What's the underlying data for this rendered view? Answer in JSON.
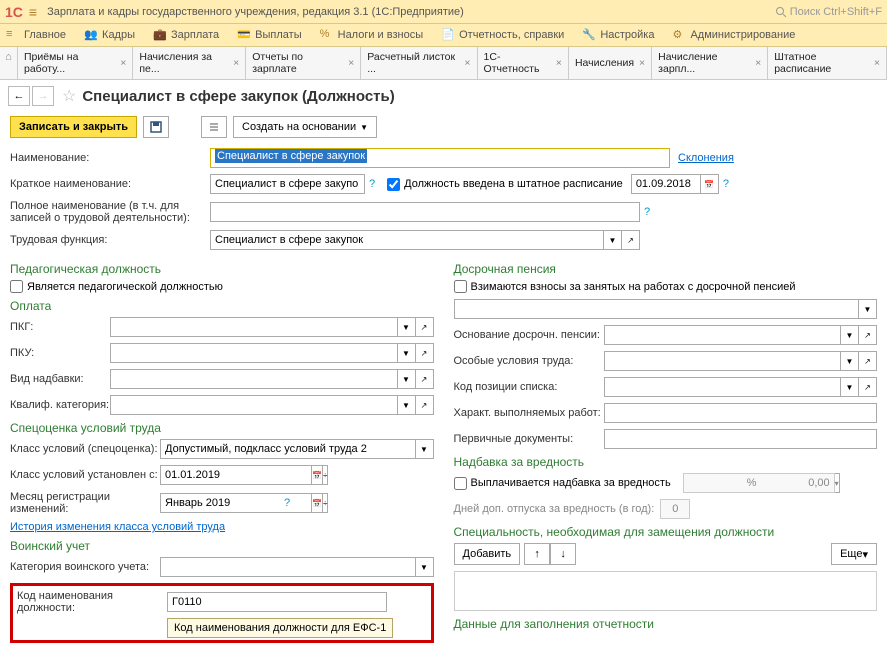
{
  "title": "Зарплата и кадры государственного учреждения, редакция 3.1 (1С:Предприятие)",
  "searchPlaceholder": "Поиск Ctrl+Shift+F",
  "menu": [
    "Главное",
    "Кадры",
    "Зарплата",
    "Выплаты",
    "Налоги и взносы",
    "Отчетность, справки",
    "Настройка",
    "Администрирование"
  ],
  "tabs": [
    "Приёмы на работу...",
    "Начисления за пе...",
    "Отчеты по зарплате",
    "Расчетный листок ...",
    "1С-Отчетность",
    "Начисления",
    "Начисление зарпл...",
    "Штатное расписание"
  ],
  "pageTitle": "Специалист в сфере закупок (Должность)",
  "toolbar": {
    "save": "Записать и закрыть",
    "create": "Создать на основании"
  },
  "lbl": {
    "name": "Наименование:",
    "short": "Краткое наименование:",
    "full": "Полное наименование (в т.ч. для записей о трудовой деятельности):",
    "func": "Трудовая функция:",
    "inStaff": "Должность введена в штатное расписание",
    "pedH": "Педагогическая должность",
    "isPed": "Является педагогической должностью",
    "payH": "Оплата",
    "pkg": "ПКГ:",
    "pku": "ПКУ:",
    "nadb": "Вид надбавки:",
    "kval": "Квалиф. категория:",
    "specH": "Спецоценка условий труда",
    "klass": "Класс условий (спецоценка):",
    "klassFrom": "Класс условий установлен с:",
    "mesReg": "Месяц регистрации изменений:",
    "histLink": "История изменения класса условий труда",
    "voinH": "Воинский учет",
    "katVoin": "Категория воинского учета:",
    "kod": "Код наименования должности:",
    "tooltip": "Код наименования должности для ЕФС-1",
    "dosH": "Досрочная пенсия",
    "vzim": "Взимаются взносы за занятых на работах с досрочной пенсией",
    "osn": "Основание досрочн. пенсии:",
    "osob": "Особые условия труда:",
    "kodPoz": "Код позиции списка:",
    "har": "Характ. выполняемых работ:",
    "perv": "Первичные документы:",
    "nadbH": "Надбавка за вредность",
    "vypl": "Выплачивается надбавка за вредность",
    "dni": "Дней доп. отпуска за вредность (в год):",
    "specReqH": "Специальность, необходимая для замещения должности",
    "add": "Добавить",
    "more": "Еще",
    "dannH": "Данные для заполнения отчетности",
    "sklon": "Склонения"
  },
  "val": {
    "name": "Специалист в сфере закупок",
    "short": "Специалист в сфере закупо",
    "func": "Специалист в сфере закупок",
    "dateIn": "01.09.2018",
    "klass": "Допустимый, подкласс условий труда 2",
    "klassFrom": "01.01.2019",
    "mesReg": "Январь 2019",
    "kod": "Г0110",
    "nadbVal": "0,00",
    "pct": "%",
    "dniVal": "0"
  }
}
